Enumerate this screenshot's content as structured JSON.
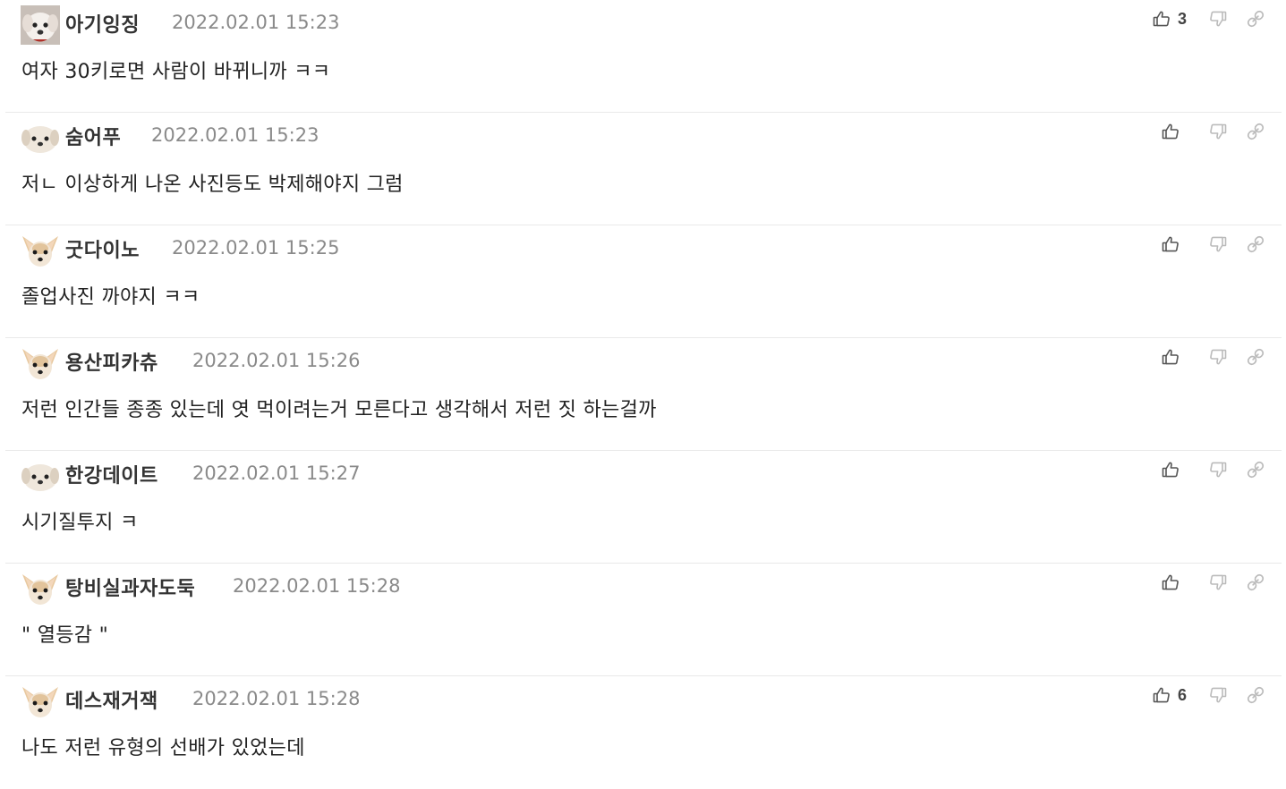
{
  "comments": [
    {
      "nick": "아기잉징",
      "date": "2022.02.01 15:23",
      "body": "여자 30키로면 사람이 바뀌니까 ㅋㅋ",
      "likes": "3",
      "avatar_icon": "maltese-puppy-icon"
    },
    {
      "nick": "숨어푸",
      "date": "2022.02.01 15:23",
      "body": "저ㄴ 이상하게 나온 사진등도 박제해야지 그럼",
      "likes": "",
      "avatar_icon": "white-puppy-icon"
    },
    {
      "nick": "굿다이노",
      "date": "2022.02.01 15:25",
      "body": "졸업사진 까야지 ㅋㅋ",
      "likes": "",
      "avatar_icon": "chihuahua-icon"
    },
    {
      "nick": "용산피카츄",
      "date": "2022.02.01 15:26",
      "body": "저런 인간들 종종 있는데 엿 먹이려는거 모른다고 생각해서 저런 짓 하는걸까",
      "likes": "",
      "avatar_icon": "chihuahua-icon"
    },
    {
      "nick": "한강데이트",
      "date": "2022.02.01 15:27",
      "body": "시기질투지 ㅋ",
      "likes": "",
      "avatar_icon": "white-puppy-icon"
    },
    {
      "nick": "탕비실과자도둑",
      "date": "2022.02.01 15:28",
      "body": "\" 열등감 \"",
      "likes": "",
      "avatar_icon": "chihuahua-icon"
    },
    {
      "nick": "데스재거잭",
      "date": "2022.02.01 15:28",
      "body": "나도 저런 유형의 선배가 있었는데",
      "likes": "6",
      "avatar_icon": "chihuahua-icon"
    }
  ],
  "colors": {
    "nick": "#333333",
    "date": "#8a8a8a",
    "body": "#222222",
    "icon": "#555555",
    "icon_muted": "#bbbbbb",
    "divider": "#e9e9e9"
  }
}
